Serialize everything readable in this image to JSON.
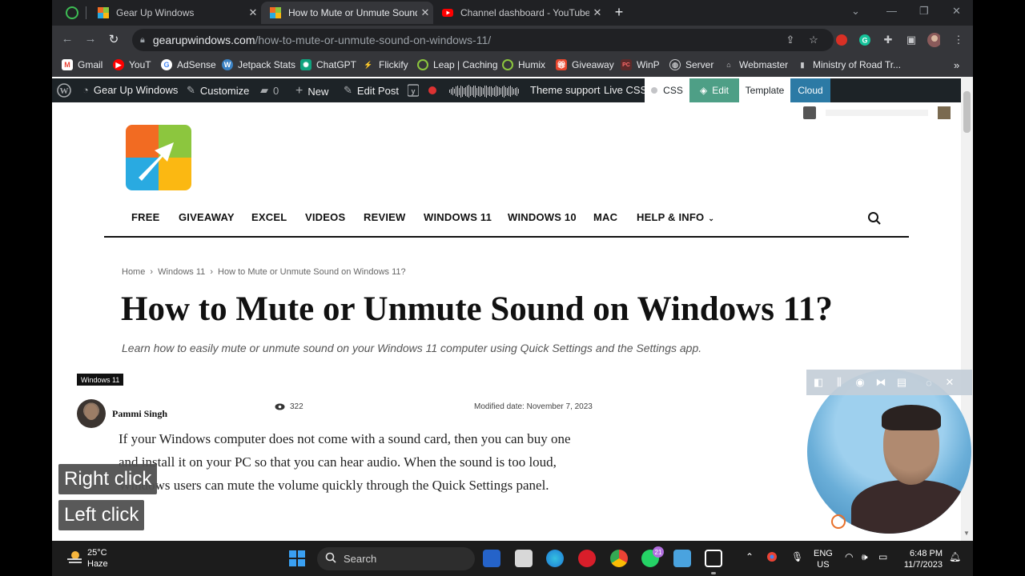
{
  "browser": {
    "tabs": [
      {
        "title": "Gear Up Windows",
        "active": false
      },
      {
        "title": "How to Mute or Unmute Sound",
        "active": true
      },
      {
        "title": "Channel dashboard - YouTube S",
        "active": false
      }
    ],
    "url_host": "gearupwindows.com",
    "url_path": "/how-to-mute-or-unmute-sound-on-windows-11/",
    "bookmarks": [
      "Gmail",
      "YouT",
      "AdSense",
      "Jetpack Stats",
      "ChatGPT",
      "Flickify",
      "Leap | Caching",
      "Humix",
      "Giveaway",
      "WinP",
      "Server",
      "Webmaster",
      "Ministry of Road Tr..."
    ],
    "more_bookmarks": "»"
  },
  "adminbar": {
    "site": "Gear Up Windows",
    "customize": "Customize",
    "comments": "0",
    "new": "New",
    "edit_post": "Edit Post",
    "theme_support": "Theme support",
    "live_css": "Live CSS",
    "css": "CSS",
    "edit": "Edit",
    "template": "Template",
    "cloud": "Cloud"
  },
  "site": {
    "menu": [
      "FREE",
      "GIVEAWAY",
      "EXCEL",
      "VIDEOS",
      "REVIEW",
      "WINDOWS 11",
      "WINDOWS 10",
      "MAC",
      "HELP & INFO"
    ]
  },
  "post": {
    "breadcrumb": {
      "home": "Home",
      "sep": "›",
      "category": "Windows 11",
      "current": "How to Mute or Unmute Sound on Windows 11?"
    },
    "title": "How to Mute or Unmute Sound on Windows 11?",
    "subtitle": "Learn how to easily mute or unmute sound on your Windows 11 computer using Quick Settings and the Settings app.",
    "category_badge": "Windows 11",
    "author": "Pammi Singh",
    "views": "322",
    "modified": "Modified date: November 7, 2023",
    "paragraph": "If your Windows computer does not come with a sound card, then you can buy one and install it on your PC so that you can hear audio. When the sound is too loud, Windows users can mute the volume quickly through the Quick Settings panel."
  },
  "overlay": {
    "right_click": "Right click",
    "left_click": "Left click"
  },
  "taskbar": {
    "temp": "25°C",
    "condition": "Haze",
    "search": "Search",
    "whatsapp_badge": "21",
    "lang1": "ENG",
    "lang2": "US",
    "time": "6:48 PM",
    "date": "11/7/2023"
  },
  "colors": {
    "wp_edit_green": "#4e9f86",
    "wp_cloud_blue": "#2c7aa5",
    "admin_bar": "#1d2327",
    "chrome_dark": "#202124"
  }
}
